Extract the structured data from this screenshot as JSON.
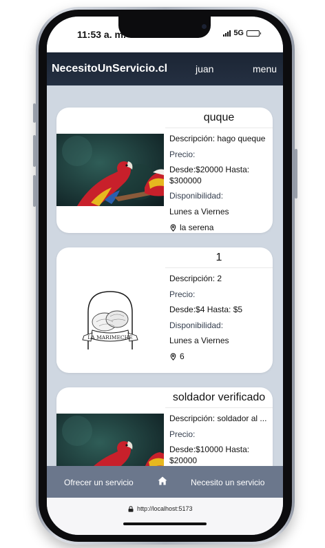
{
  "status_bar": {
    "time": "11:53 a. m.",
    "network": "5G",
    "battery_level": 0.9
  },
  "header": {
    "brand": "NecesitoUnServicio.cl",
    "user": "juan",
    "menu": "menu"
  },
  "services": [
    {
      "title": "quque",
      "image": "parrot-photo",
      "description": "Descripción: hago queque",
      "price_label": "Precio:",
      "price": "Desde:$20000 Hasta: $300000",
      "availability_label": "Disponibilidad:",
      "availability": "Lunes a Viernes",
      "location": "la serena"
    },
    {
      "title": "1",
      "image": "la-marimeche-logo",
      "image_text": "LA MARIMECHE",
      "description": "Descripción: 2",
      "price_label": "Precio:",
      "price": "Desde:$4 Hasta: $5",
      "availability_label": "Disponibilidad:",
      "availability": "Lunes a Viernes",
      "location": "6"
    },
    {
      "title": "soldador verificado",
      "image": "parrot-photo",
      "description": "Descripción: soldador al ...",
      "price_label": "Precio:",
      "price": "Desde:$10000 Hasta: $20000"
    }
  ],
  "bottom_nav": {
    "offer": "Ofrecer un servicio",
    "home_icon": "home-icon",
    "need": "Necesito un servicio"
  },
  "browser": {
    "url": "http://localhost:5173"
  },
  "colors": {
    "header_bg": "#1f2a3a",
    "content_bg": "#cfd7e1",
    "bottom_nav_bg": "#6b778c"
  }
}
